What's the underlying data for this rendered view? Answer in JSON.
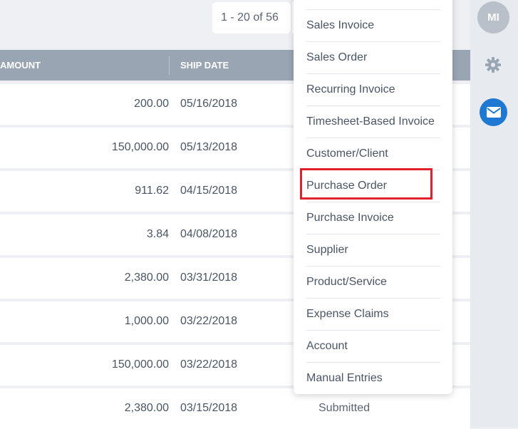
{
  "pagination": {
    "range_text": "1 - 20 of 56"
  },
  "table": {
    "headers": {
      "amount": "AMOUNT",
      "ship_date": "SHIP DATE"
    },
    "rows": [
      {
        "amount": "200.00",
        "ship_date": "05/16/2018",
        "status": ""
      },
      {
        "amount": "150,000.00",
        "ship_date": "05/13/2018",
        "status": ""
      },
      {
        "amount": "911.62",
        "ship_date": "04/15/2018",
        "status": ""
      },
      {
        "amount": "3.84",
        "ship_date": "04/08/2018",
        "status": ""
      },
      {
        "amount": "2,380.00",
        "ship_date": "03/31/2018",
        "status": ""
      },
      {
        "amount": "1,000.00",
        "ship_date": "03/22/2018",
        "status": ""
      },
      {
        "amount": "150,000.00",
        "ship_date": "03/22/2018",
        "status": ""
      },
      {
        "amount": "2,380.00",
        "ship_date": "03/15/2018",
        "status": "Submitted"
      }
    ]
  },
  "menu": {
    "items": [
      "Sales Invoice",
      "Sales Order",
      "Recurring Invoice",
      "Timesheet-Based Invoice",
      "Customer/Client",
      "Purchase Order",
      "Purchase Invoice",
      "Supplier",
      "Product/Service",
      "Expense Claims",
      "Account",
      "Manual Entries"
    ],
    "highlighted": "Purchase Order"
  },
  "rail": {
    "avatar_initials": "MI",
    "accent_color": "#1f78d1",
    "highlight_color": "#e0202a"
  }
}
